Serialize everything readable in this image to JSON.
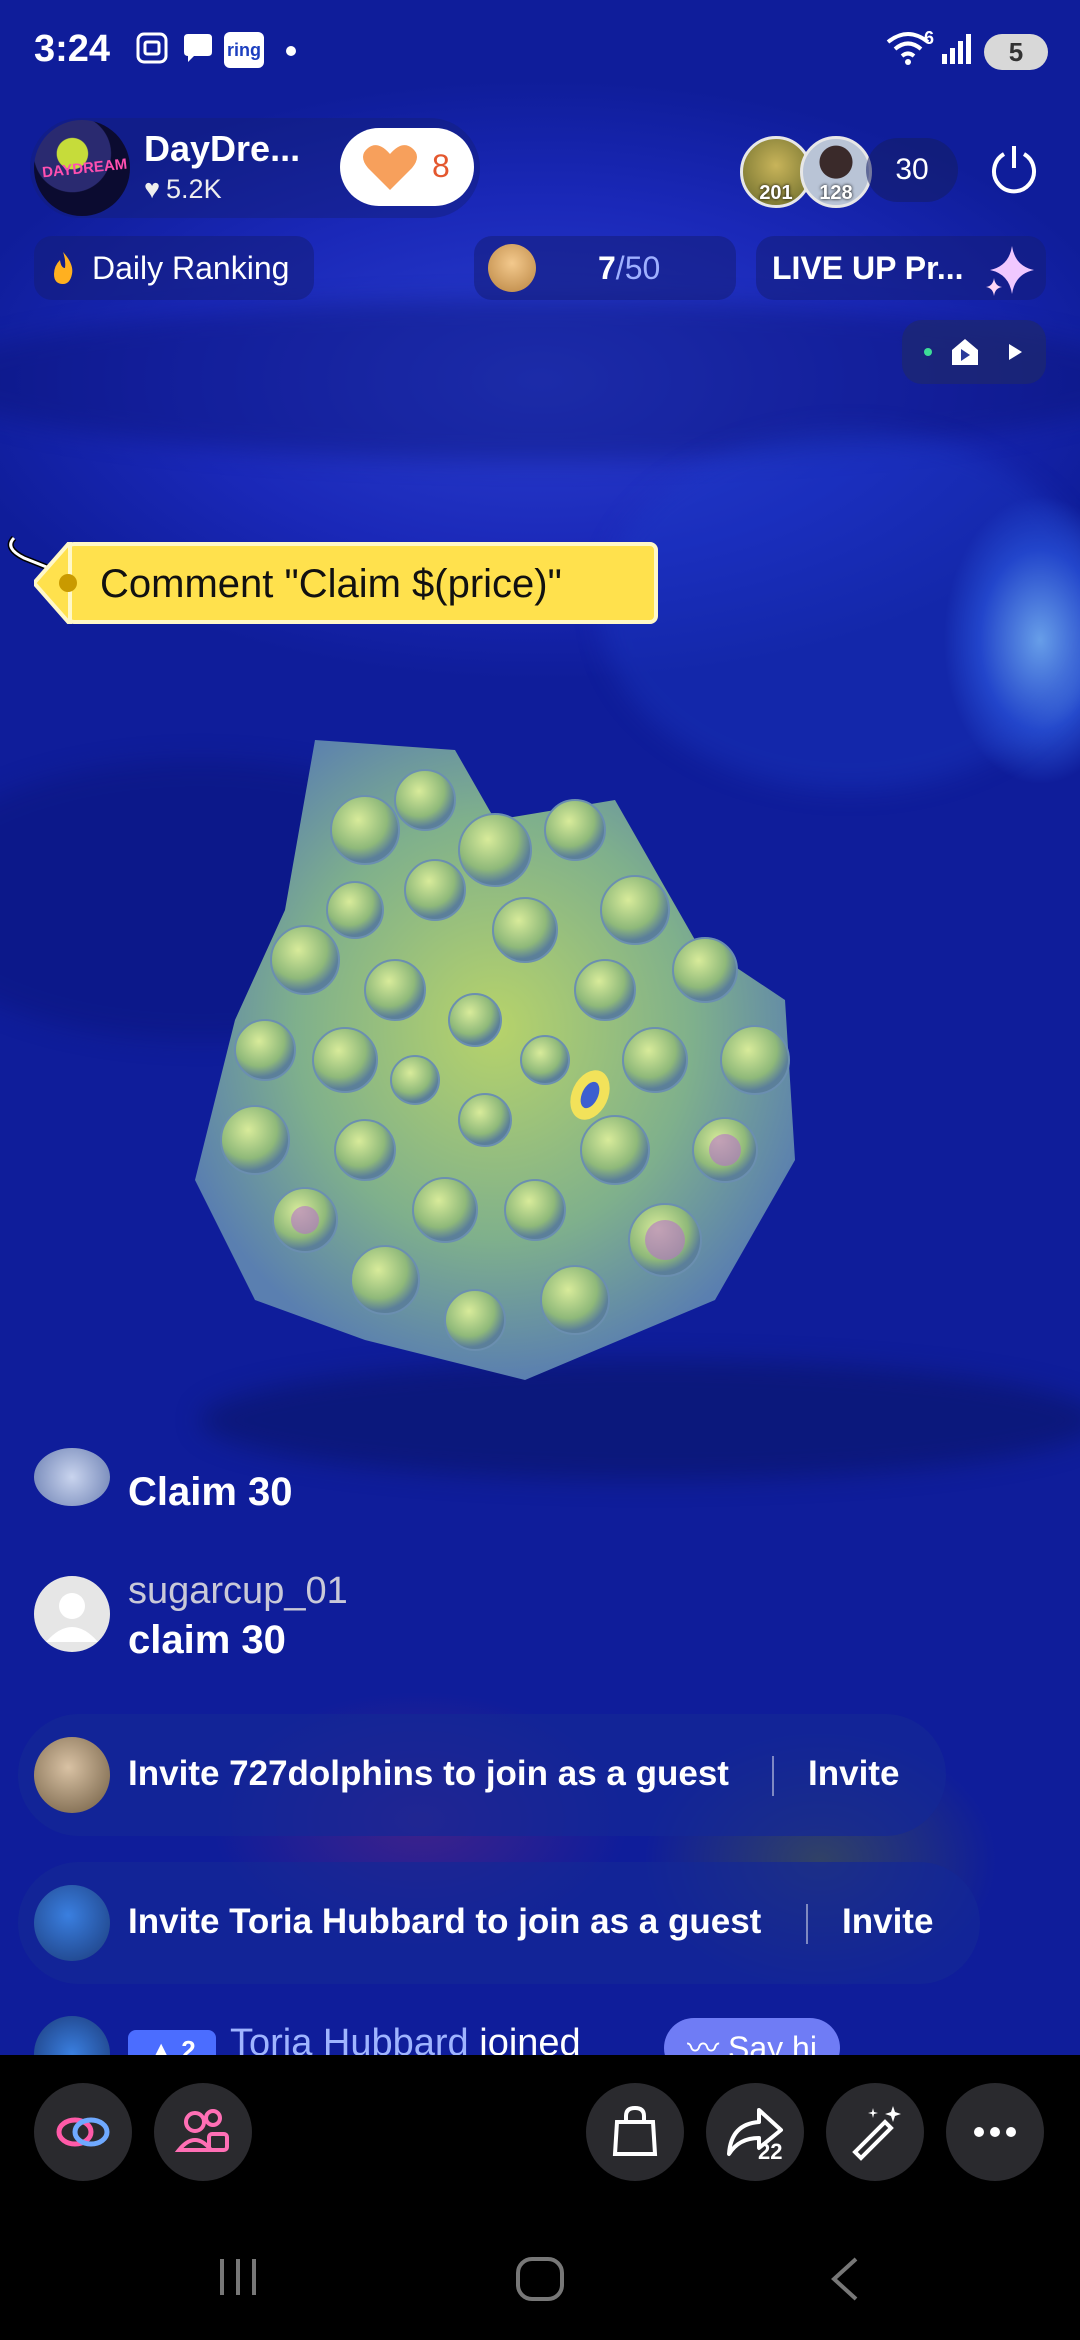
{
  "status_bar": {
    "time": "3:24",
    "ring_label": "ring",
    "wifi_superscript": "6",
    "battery": "5"
  },
  "host": {
    "name": "DayDre...",
    "likes": "5.2K",
    "logo_text": "DAYDREAM",
    "gift_count": "8"
  },
  "viewers": {
    "viewer1_count": "201",
    "viewer2_count": "128",
    "total": "30"
  },
  "chips": {
    "daily_ranking": "Daily Ranking",
    "progress_current": "7",
    "progress_total": "/50",
    "live_up": "LIVE UP Pr..."
  },
  "tag": {
    "text": "Comment \"Claim $(price)\""
  },
  "chat": [
    {
      "user": "",
      "message": "Claim 30"
    },
    {
      "user": "sugarcup_01",
      "message": "claim 30"
    }
  ],
  "invites": [
    {
      "text": "Invite 727dolphins to join as a guest",
      "button": "Invite"
    },
    {
      "text": "Invite Toria Hubbard to join as a guest",
      "button": "Invite"
    }
  ],
  "peek": {
    "badge": "2",
    "name": "Toria Hubbard",
    "action": "joined",
    "say_hi": "Say hi"
  },
  "bottom_bar": {
    "share_count": "22"
  },
  "colors": {
    "tag_yellow": "#ffe14d",
    "gift_heart": "#f7a05c",
    "background_blue": "#1f33c8"
  }
}
